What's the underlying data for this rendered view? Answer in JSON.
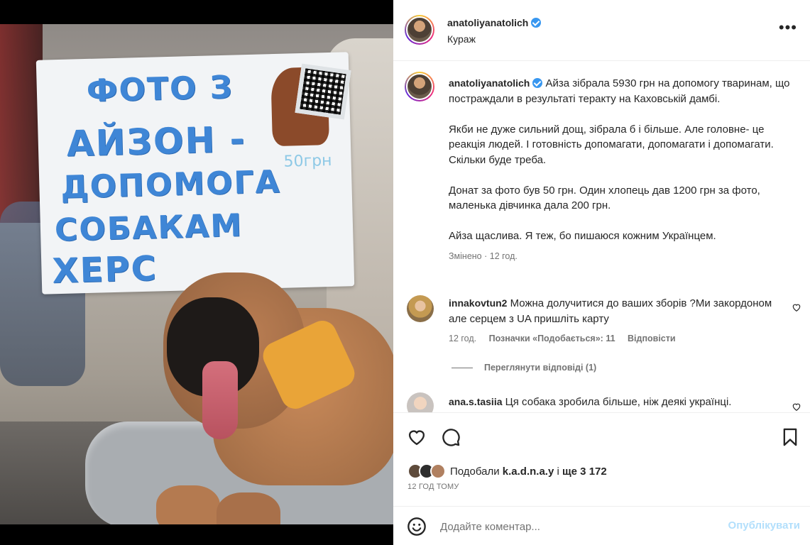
{
  "post": {
    "author": "anatoliyanatolich",
    "location": "Кураж",
    "more_label": "•••"
  },
  "photo": {
    "sign_lines": [
      "ФОТО З",
      "АЙЗОН -",
      "ДОПОМОГА",
      "СОБАКАМ",
      "ХЕРС"
    ],
    "sign_price": "50грн"
  },
  "caption": {
    "author": "anatoliyanatolich",
    "paragraph1": "Айза зібрала 5930 грн на допомогу тваринам, що постраждали в результаті теракту на Каховській дамбі.",
    "paragraph2": "Якби не дуже сильний дощ, зібрала б і більше. Але головне- це реакція людей. І готовність допомагати, допомагати і допомагати. Скільки буде треба.",
    "paragraph3": "Донат за фото був 50 грн. Один хлопець дав 1200 грн за фото, маленька дівчинка дала 200 грн.",
    "paragraph4": "Айза щаслива. Я теж, бо пишаюся кожним Українцем.",
    "edited": "Змінено",
    "time": "12 год."
  },
  "comments": [
    {
      "user": "innakovtun2",
      "text": "Можна долучитися до ваших зборів ?Ми закордоном але серцем з UA пришліть карту",
      "time": "12 год.",
      "likes": "Позначки «Подобається»: 11",
      "reply": "Відповісти",
      "view_replies": "Переглянути відповіді (1)"
    },
    {
      "user": "ana.s.tasiia",
      "text": "Ця собака зробила більше, ніж деякі українці."
    }
  ],
  "likes": {
    "prefix": "Подобали",
    "user": "k.a.d.n.a.y",
    "and": "і",
    "rest": "ще 3 172"
  },
  "time_ago": "12 ГОД ТОМУ",
  "add_comment": {
    "placeholder": "Додайте коментар...",
    "publish_label": "Опублікувати"
  },
  "colors": {
    "verified": "#3897f0",
    "publish_disabled": "#b2dffc",
    "secondary_text": "#737373"
  },
  "icons": [
    "verified-badge-icon",
    "more-options-icon",
    "heart-icon",
    "comment-icon",
    "bookmark-icon",
    "emoji-icon"
  ]
}
